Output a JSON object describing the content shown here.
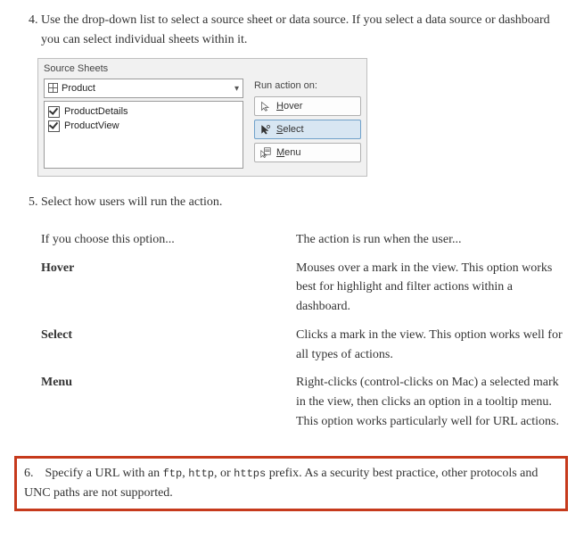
{
  "steps": {
    "s4": {
      "num": "4.",
      "text": "Use the drop-down list to select a source sheet or data source. If you select a data source or dashboard you can select individual sheets within it."
    },
    "dialog": {
      "group_label": "Source Sheets",
      "dropdown_value": "Product",
      "list_items": [
        "ProductDetails",
        "ProductView"
      ],
      "run_label": "Run action on:",
      "buttons": {
        "hover_pre": "",
        "hover_u": "H",
        "hover_rest": "over",
        "select_pre": "",
        "select_u": "S",
        "select_rest": "elect",
        "menu_pre": "",
        "menu_u": "M",
        "menu_rest": "enu"
      }
    },
    "s5": {
      "text": "Select how users will run the action.",
      "header_left": "If you choose this option...",
      "header_right": "The action is run when the user...",
      "rows": {
        "hover": {
          "label": "Hover",
          "desc": "Mouses over a mark in the view. This option works best for highlight and filter actions within a dashboard."
        },
        "select": {
          "label": "Select",
          "desc": "Clicks a mark in the view. This option works well for all types of actions."
        },
        "menu": {
          "label": "Menu",
          "desc": "Right-clicks (control-clicks on Mac) a selected mark in the view, then clicks an option in a tooltip menu. This option works particularly well for URL actions."
        }
      }
    },
    "s6": {
      "pre": "Specify a URL with an ",
      "c1": "ftp",
      "sep1": ", ",
      "c2": "http",
      "sep2": ", or ",
      "c3": "https",
      "post": " prefix. As a security best practice, other protocols and UNC paths are not supported."
    }
  }
}
